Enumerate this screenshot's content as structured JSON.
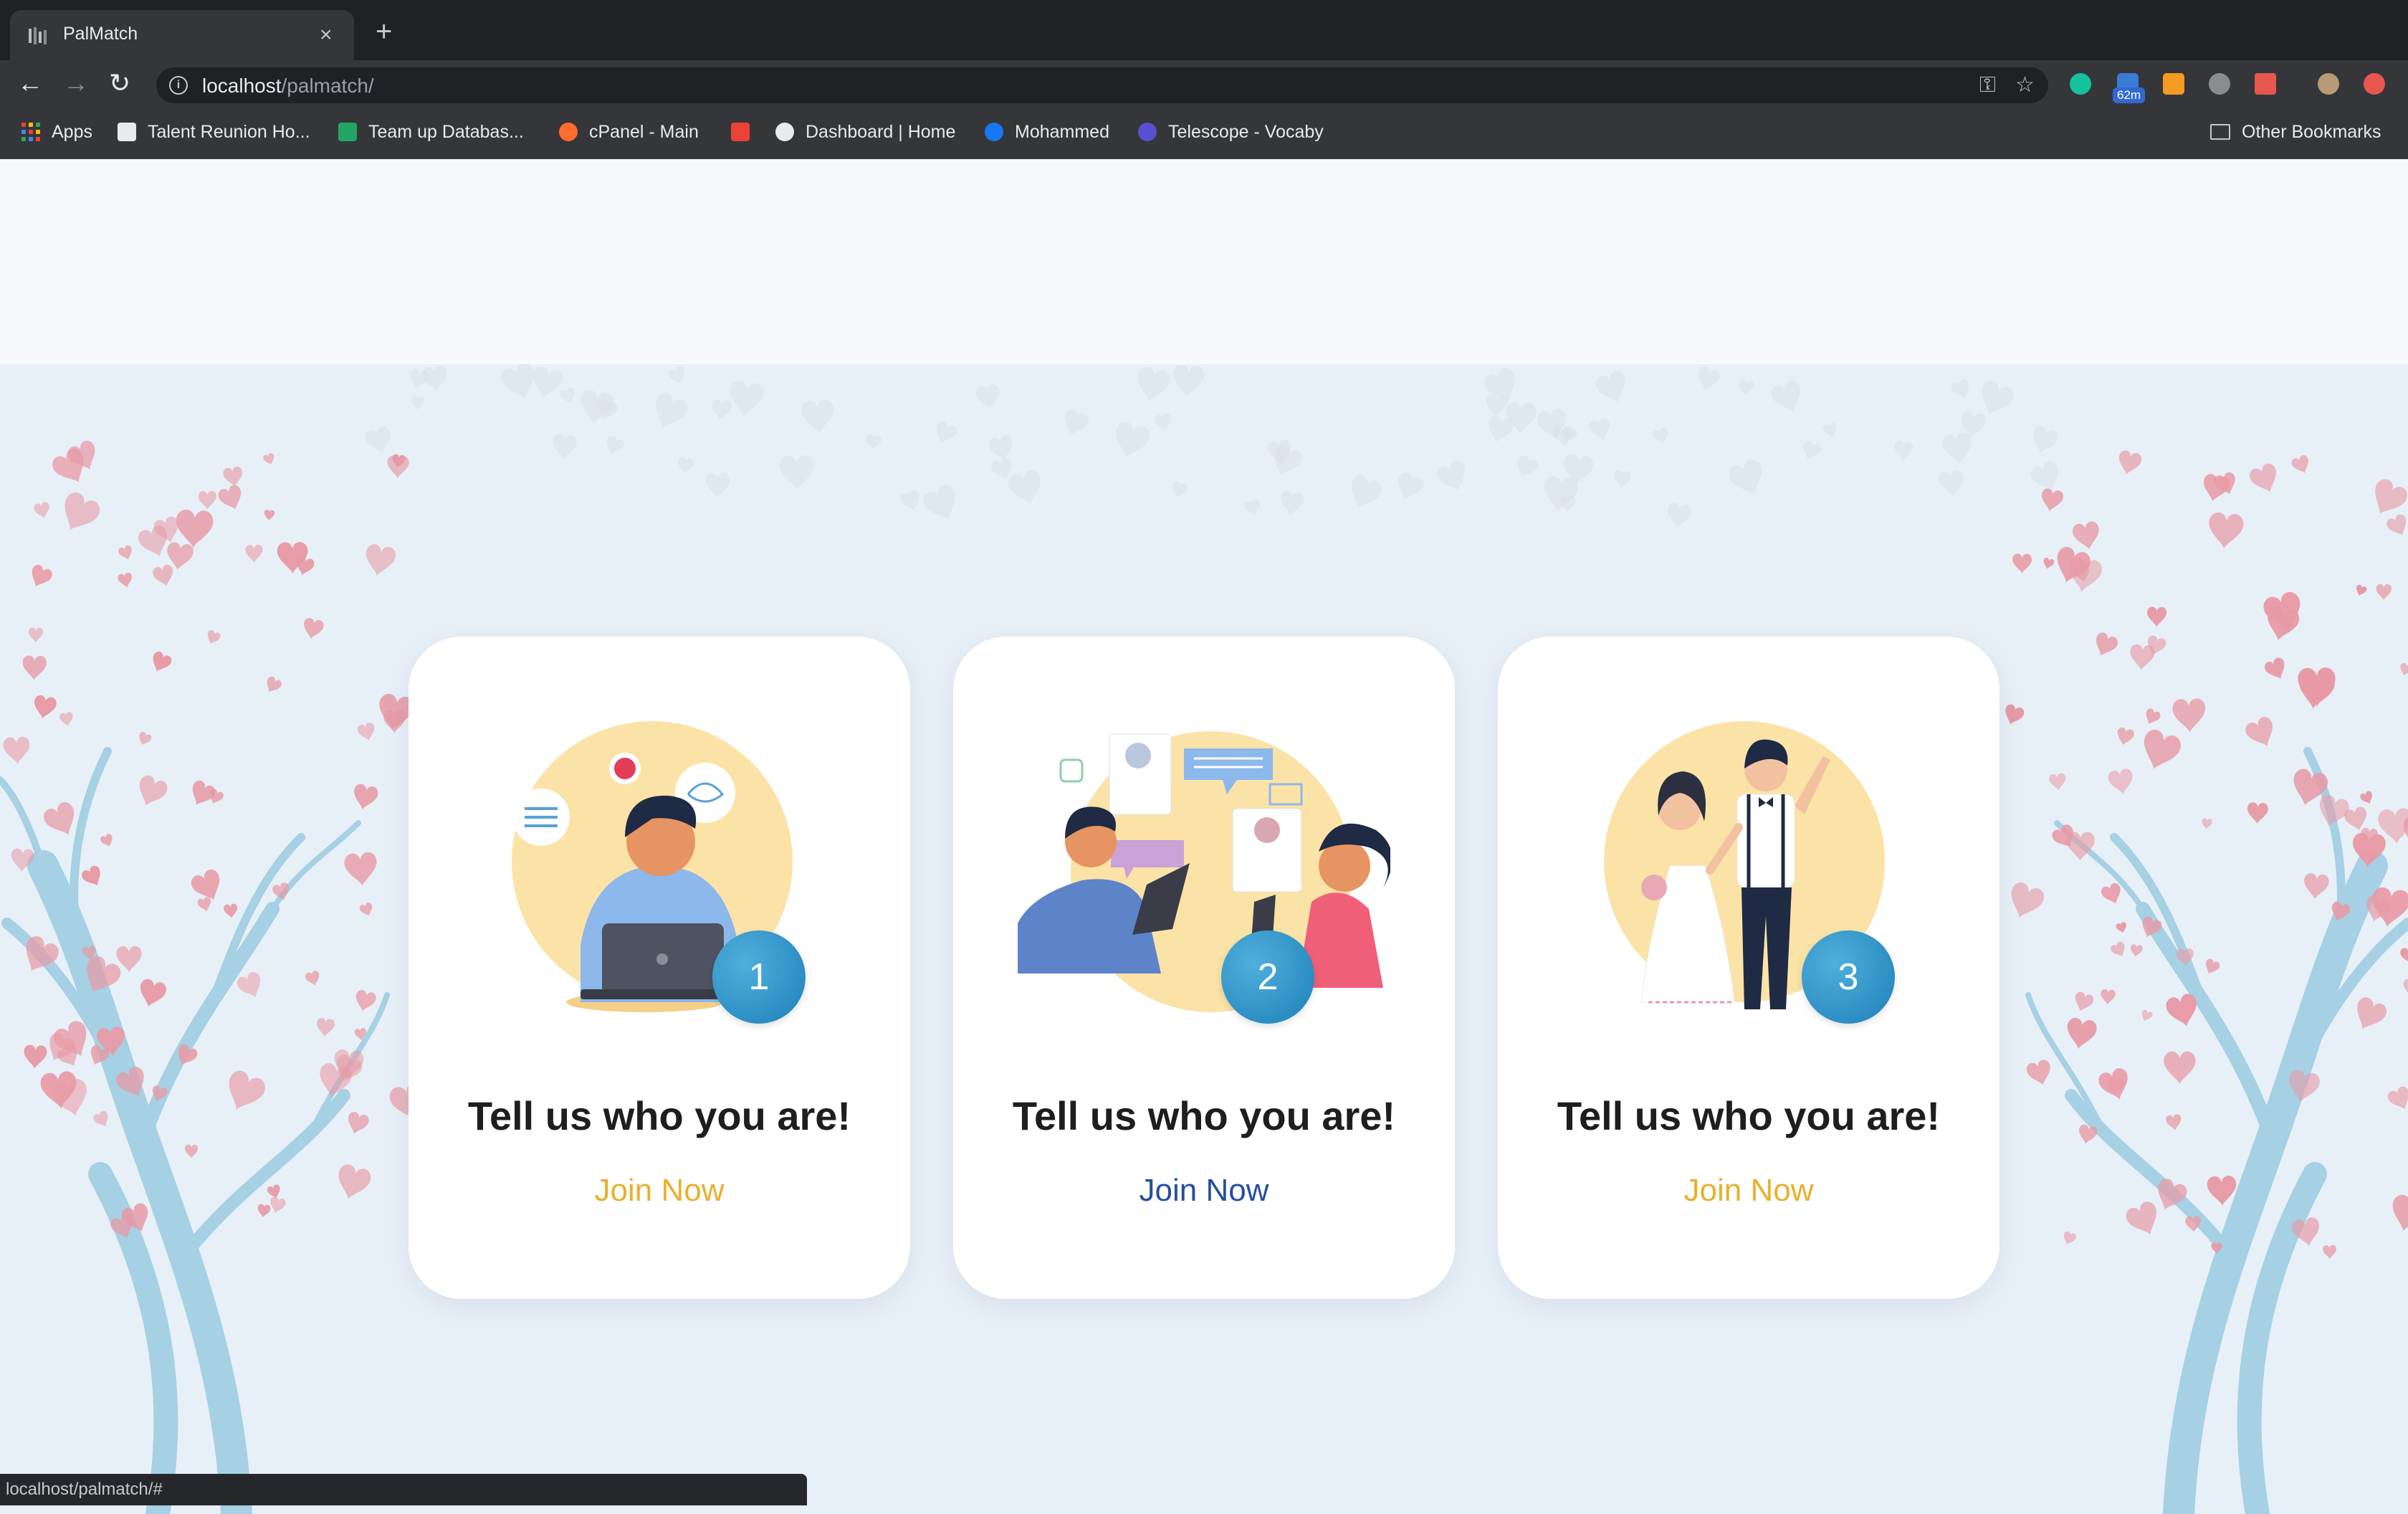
{
  "browser": {
    "tab_title": "PalMatch",
    "tab_close": "×",
    "new_tab": "+",
    "url_host": "localhost",
    "url_path": "/palmatch/",
    "extension_badge": "62m",
    "bookmarks": [
      {
        "label": "Apps",
        "icon": "apps-grid-icon"
      },
      {
        "label": "Talent Reunion Ho...",
        "icon": "talent-reunion-icon",
        "color": "#e8eaed"
      },
      {
        "label": "Team up Databas...",
        "icon": "sheets-icon",
        "color": "#23a566"
      },
      {
        "label": "cPanel - Main",
        "icon": "cpanel-icon",
        "color": "#ff6c2c"
      },
      {
        "label": "",
        "icon": "gmail-icon",
        "color": "#ea4335"
      },
      {
        "label": "Dashboard | Home",
        "icon": "globe-icon",
        "color": "#e8eaed"
      },
      {
        "label": "Mohammed",
        "icon": "facebook-icon",
        "color": "#1877f2"
      },
      {
        "label": "Telescope - Vocaby",
        "icon": "telescope-icon",
        "color": "#5b4fd1"
      }
    ],
    "other_bookmarks": "Other Bookmarks",
    "status_url": "localhost/palmatch/#"
  },
  "cards": [
    {
      "number": "1",
      "heading": "Tell us who you are!",
      "link": "Join Now",
      "illustration": "person-laptop-illustration"
    },
    {
      "number": "2",
      "heading": "Tell us who you are!",
      "link": "Join Now",
      "illustration": "chatting-couple-illustration"
    },
    {
      "number": "3",
      "heading": "Tell us who you are!",
      "link": "Join Now",
      "illustration": "wedding-couple-illustration"
    }
  ],
  "colors": {
    "step_badge": "#2b92c9",
    "link_default": "#e8b12c",
    "link_active": "#244fa0",
    "band_background": "#e8f0f7",
    "heart": "#e79aa6",
    "tree": "#9fcde2"
  }
}
